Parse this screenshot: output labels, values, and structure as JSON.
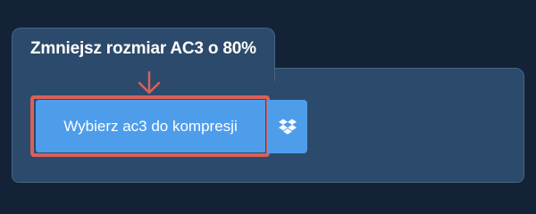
{
  "panel": {
    "title": "Zmniejsz rozmiar AC3 o 80%"
  },
  "upload": {
    "choose_label": "Wybierz ac3 do kompresji",
    "dropbox_icon": "dropbox-icon",
    "arrow_icon": "arrow-down-icon"
  },
  "colors": {
    "page_background": "#132236",
    "panel_background": "#2c4a6b",
    "button": "#4e9deb",
    "highlight": "#d9605a"
  }
}
